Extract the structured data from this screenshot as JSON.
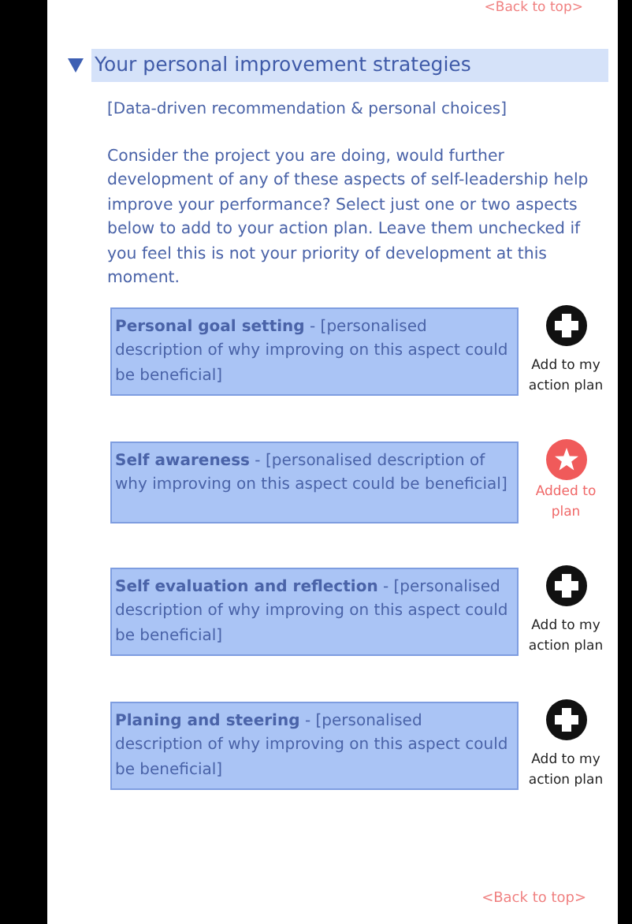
{
  "top_link": "<Back to top>",
  "section": {
    "title": "Your personal improvement strategies",
    "expanded": true
  },
  "subtitle": "[Data-driven recommendation & personal choices]",
  "intro": "Consider the project you are doing, would further development of any of these aspects of self-leadership help improve your performance? Select just one or two aspects below to add to your action plan. Leave them unchecked if you feel this is not your priority of development at this moment.",
  "aspects": [
    {
      "text": "**Personal goal setting** -  [personalised description of why improving on this aspect could be beneficial]",
      "added": false,
      "action_label": "Add to my action plan"
    },
    {
      "text": "**Self awareness** - [personalised description of why improving on this aspect could be beneficial]",
      "added": true,
      "action_label": "Added to plan"
    },
    {
      "text": "**Self evaluation and reflection** - [personalised description of why improving on this aspect could be beneficial]",
      "added": false,
      "action_label": "Add to my action plan"
    },
    {
      "text": "**Planing and steering** - [personalised description of why improving on this aspect could be beneficial]",
      "added": false,
      "action_label": "Add to my action plan"
    }
  ],
  "bottom_link": "<Back to top>"
}
